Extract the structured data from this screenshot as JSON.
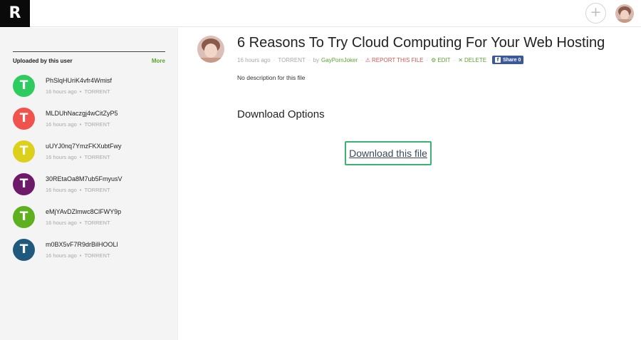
{
  "header": {
    "logo": "R",
    "add_icon": "plus-icon",
    "add_symbol": "+"
  },
  "sidebar": {
    "title": "Uploaded by this user",
    "more_label": "More",
    "items": [
      {
        "letter": "T",
        "name": "PhSlqHUriK4vfr4Wmisf",
        "time": "16 hours ago",
        "type": "TORRENT",
        "color": "#2ecc5f"
      },
      {
        "letter": "T",
        "name": "MLDUhNaczgj4wCitZyP5",
        "time": "16 hours ago",
        "type": "TORRENT",
        "color": "#f0524c"
      },
      {
        "letter": "T",
        "name": "uUYJ0nq7YmzFKXubtFwy",
        "time": "16 hours ago",
        "type": "TORRENT",
        "color": "#dcd01a"
      },
      {
        "letter": "T",
        "name": "30REtaOa8M7ub5FmyusV",
        "time": "16 hours ago",
        "type": "TORRENT",
        "color": "#6e1a6b"
      },
      {
        "letter": "T",
        "name": "eMjYAvDZlmwc8ClFWY9p",
        "time": "16 hours ago",
        "type": "TORRENT",
        "color": "#5fb01f"
      },
      {
        "letter": "T",
        "name": "m0BX5vF7R9drBilHOOLl",
        "time": "16 hours ago",
        "type": "TORRENT",
        "color": "#1f5a7e"
      }
    ]
  },
  "file": {
    "title": "6 Reasons To Try Cloud Computing For Your Web Hosting",
    "time": "16 hours ago",
    "type": "TORRENT",
    "by_label": "by",
    "user": "GayPornJoker",
    "report_label": "REPORT THIS FILE",
    "edit_label": "EDIT",
    "delete_label": "DELETE",
    "share_label": "Share 0",
    "share_f": "f",
    "description": "No description for this file"
  },
  "download": {
    "heading": "Download Options",
    "button_label": "Download this file"
  },
  "colors": {
    "accent_green": "#5aa52f",
    "report_red": "#d9534f",
    "download_border": "#3cb371",
    "facebook_blue": "#3b5998"
  }
}
